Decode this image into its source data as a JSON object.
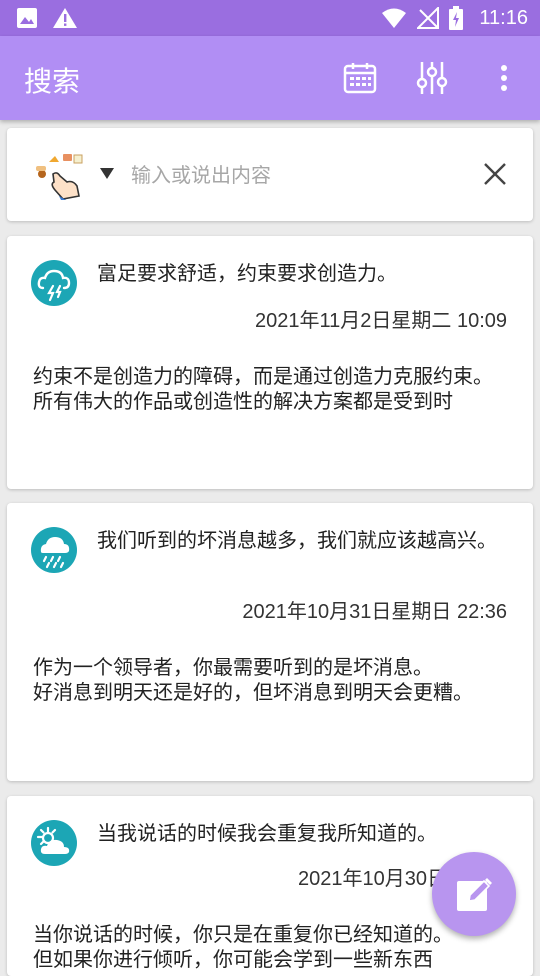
{
  "status_bar": {
    "time": "11:16"
  },
  "app_bar": {
    "title": "搜索"
  },
  "search": {
    "placeholder": "输入或说出内容"
  },
  "cards": [
    {
      "title": "富足要求舒适，约束要求创造力。",
      "date": "2021年11月2日星期二 10:09",
      "body": "约束不是创造力的障碍，而是通过创造力克服约束。\n所有伟大的作品或创造性的解决方案都是受到时",
      "icon": "thunderstorm-cloud-icon"
    },
    {
      "title": "我们听到的坏消息越多，我们就应该越高兴。",
      "date": "2021年10月31日星期日 22:36",
      "body": "作为一个领导者，你最需要听到的是坏消息。\n好消息到明天还是好的，但坏消息到明天会更糟。",
      "icon": "rain-cloud-icon"
    },
    {
      "title": "当我说话的时候我会重复我所知道的。",
      "date": "2021年10月30日星期六",
      "body": "当你说话的时候，你只是在重复你已经知道的。\n但如果你进行倾听，你可能会学到一些新东西",
      "icon": "partly-sunny-icon"
    }
  ],
  "colors": {
    "status_bar": "#9a6ee0",
    "app_bar": "#b18ef4",
    "icon_teal": "#1ca6b5",
    "fab": "#b895ef"
  }
}
